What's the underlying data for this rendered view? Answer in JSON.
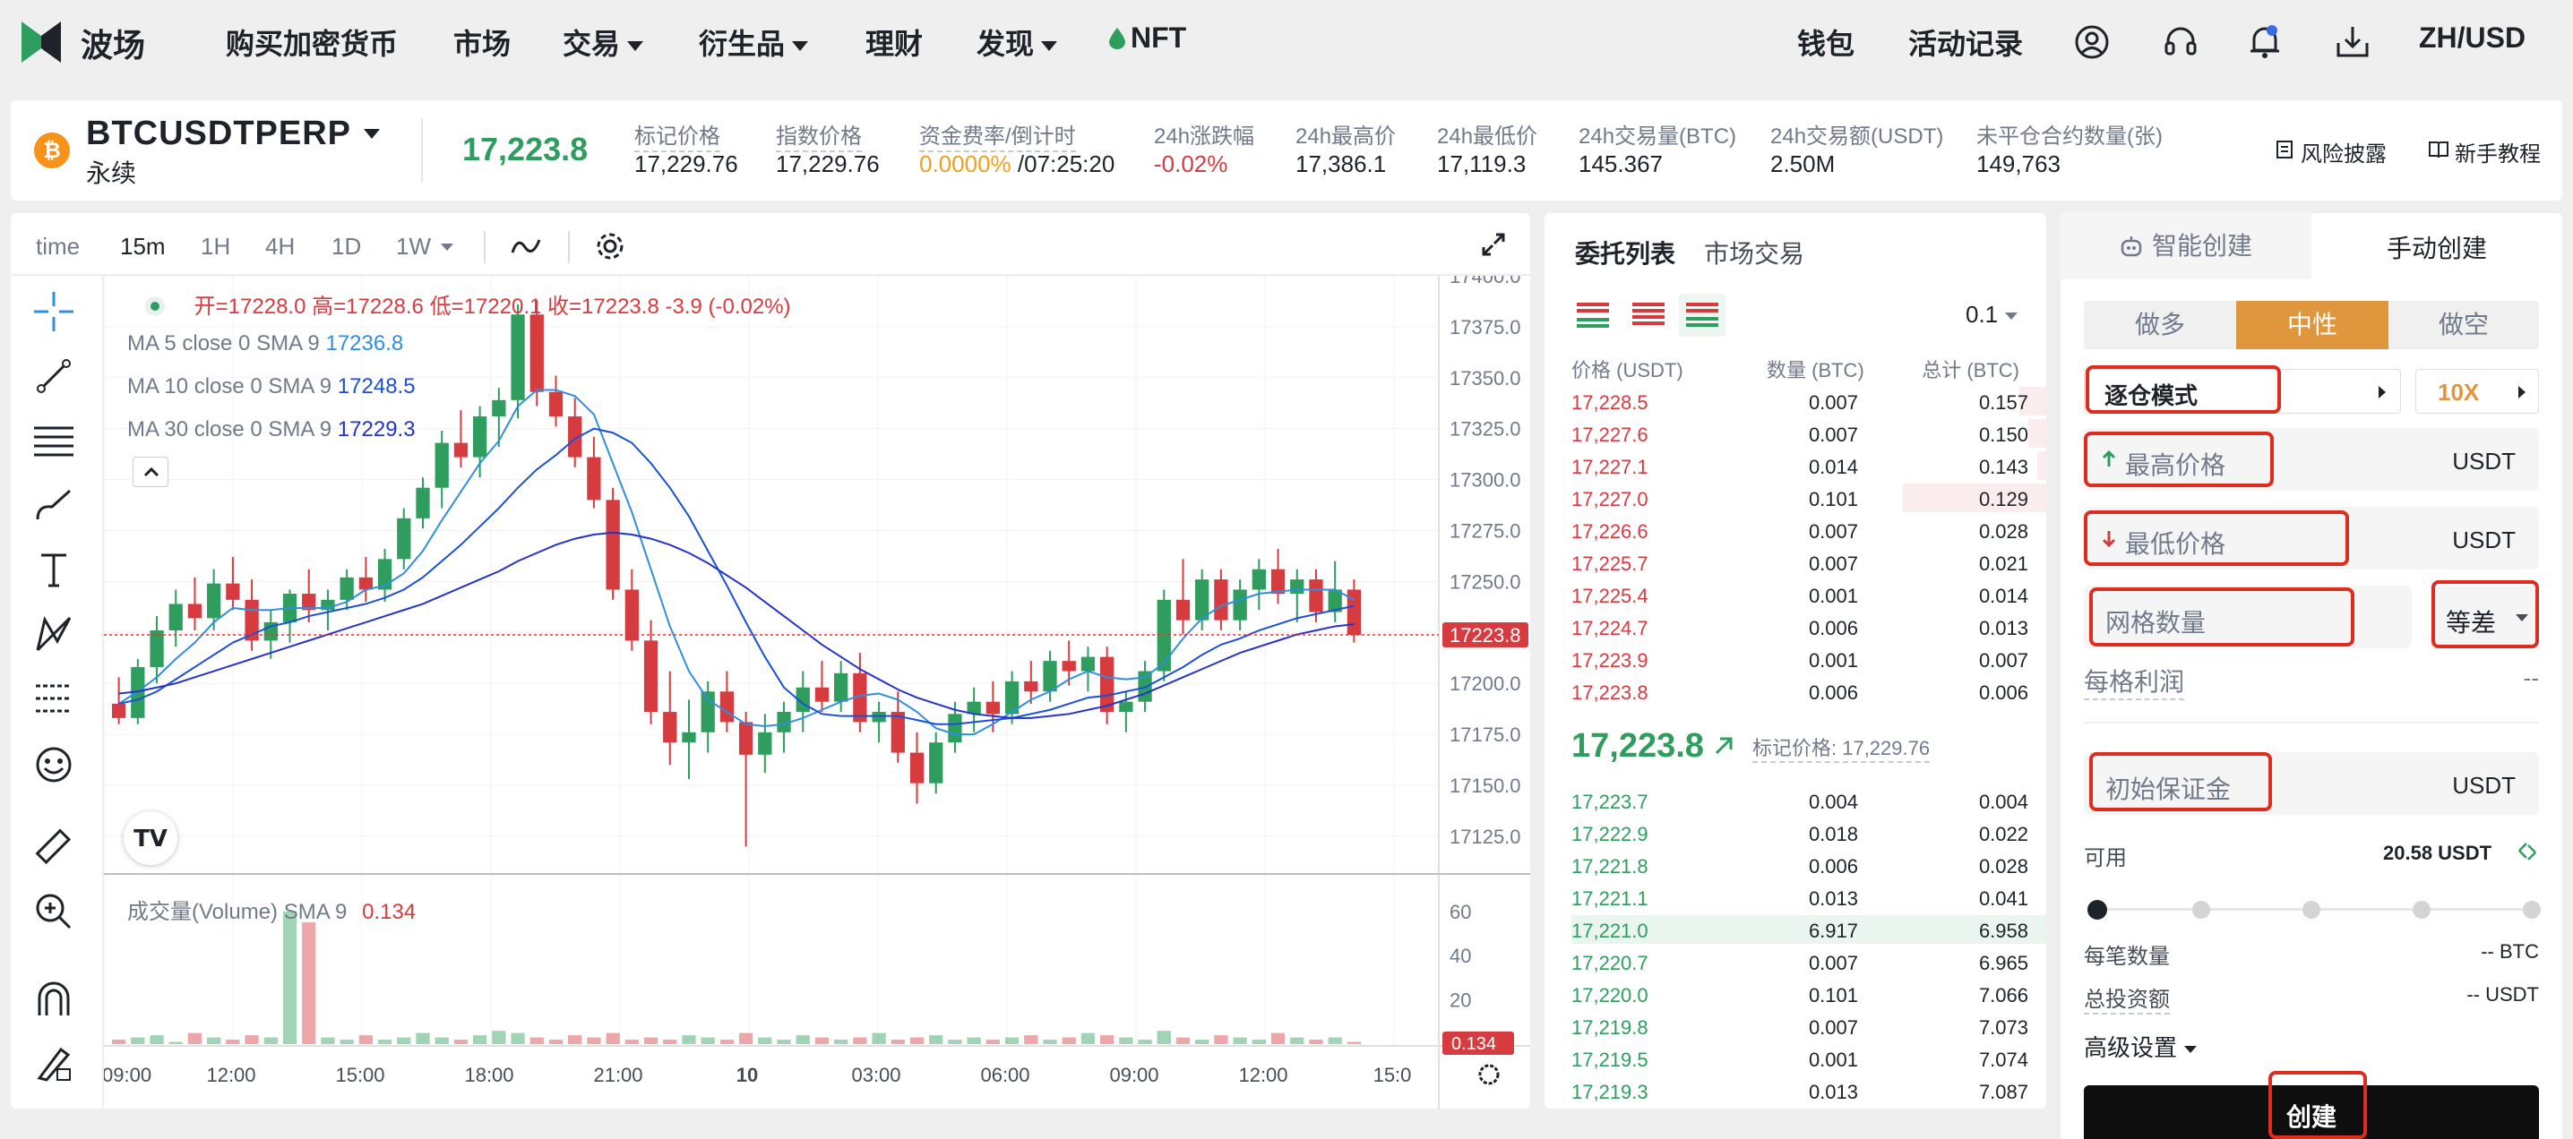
{
  "brand": {
    "name": "波场"
  },
  "nav": {
    "left": [
      {
        "label": "购买加密货币",
        "dd": false
      },
      {
        "label": "市场",
        "dd": false
      },
      {
        "label": "交易",
        "dd": true
      },
      {
        "label": "衍生品",
        "dd": true
      },
      {
        "label": "理财",
        "dd": false
      },
      {
        "label": "发现",
        "dd": true
      },
      {
        "label": "NFT",
        "dd": false
      }
    ],
    "right": {
      "wallet": "钱包",
      "activity": "活动记录",
      "lang": "ZH/USD"
    }
  },
  "ticker": {
    "symbol": "BTCUSDTPERP",
    "type": "永续",
    "price": "17,223.8",
    "stats": [
      {
        "label": "标记价格",
        "value": "17,229.76"
      },
      {
        "label": "指数价格",
        "value": "17,229.76"
      },
      {
        "label": "资金费率/倒计时",
        "value": "0.0000%",
        "value2": " /07:25:20"
      },
      {
        "label": "24h涨跌幅",
        "value": "-0.02%"
      },
      {
        "label": "24h最高价",
        "value": "17,386.1"
      },
      {
        "label": "24h最低价",
        "value": "17,119.3"
      },
      {
        "label": "24h交易量(BTC)",
        "value": "145.367"
      },
      {
        "label": "24h交易额(USDT)",
        "value": "2.50M"
      },
      {
        "label": "未平仓合约数量(张)",
        "value": "149,763"
      }
    ],
    "risk": "风险披露",
    "guide": "新手教程"
  },
  "colors": {
    "up": "#2e9d5e",
    "down": "#d63b3f",
    "accent": "#e0963c",
    "highlight": "#e02b1f"
  },
  "chart": {
    "toolbar": [
      "time",
      "15m",
      "1H",
      "4H",
      "1D",
      "1W"
    ],
    "active_interval": "15m",
    "legend": {
      "open": "开=17228.0",
      "high": "高=17228.6",
      "low": "低=17220.1",
      "close": "收=17223.8",
      "change": "-3.9 (-0.02%)"
    },
    "ma": [
      {
        "label": "MA 5 close 0 SMA 9",
        "value": "17236.8",
        "color": "#2f8ee0"
      },
      {
        "label": "MA 10 close 0 SMA 9",
        "value": "17248.5",
        "color": "#1a4fd8"
      },
      {
        "label": "MA 30 close 0 SMA 9",
        "value": "17229.3",
        "color": "#2433c8"
      }
    ],
    "volume_label": "成交量(Volume) SMA 9",
    "volume_value": "0.134",
    "price_ticks": [
      "17400.0",
      "17375.0",
      "17350.0",
      "17325.0",
      "17300.0",
      "17275.0",
      "17250.0",
      "17225.0",
      "17200.0",
      "17175.0",
      "17150.0",
      "17125.0"
    ],
    "current_price_tag": "17223.8",
    "volume_ticks": [
      "60",
      "40",
      "20"
    ],
    "volume_tag": "0.134",
    "time_ticks": [
      "09:00",
      "12:00",
      "15:00",
      "18:00",
      "21:00",
      "10",
      "03:00",
      "06:00",
      "09:00",
      "12:00",
      "15:0"
    ]
  },
  "chart_data": {
    "type": "candlestick",
    "ylim": [
      17110,
      17400
    ],
    "candles": [
      [
        17190,
        17203,
        17180,
        17183
      ],
      [
        17183,
        17212,
        17180,
        17208
      ],
      [
        17208,
        17233,
        17200,
        17226
      ],
      [
        17226,
        17246,
        17218,
        17239
      ],
      [
        17239,
        17252,
        17226,
        17232
      ],
      [
        17232,
        17256,
        17226,
        17249
      ],
      [
        17249,
        17262,
        17236,
        17241
      ],
      [
        17241,
        17251,
        17216,
        17221
      ],
      [
        17221,
        17236,
        17212,
        17230
      ],
      [
        17230,
        17246,
        17220,
        17244
      ],
      [
        17244,
        17256,
        17230,
        17236
      ],
      [
        17236,
        17246,
        17226,
        17241
      ],
      [
        17241,
        17256,
        17236,
        17252
      ],
      [
        17252,
        17262,
        17240,
        17246
      ],
      [
        17246,
        17266,
        17240,
        17261
      ],
      [
        17261,
        17286,
        17256,
        17281
      ],
      [
        17281,
        17301,
        17276,
        17296
      ],
      [
        17296,
        17324,
        17286,
        17318
      ],
      [
        17318,
        17334,
        17306,
        17311
      ],
      [
        17311,
        17336,
        17301,
        17331
      ],
      [
        17331,
        17345,
        17316,
        17339
      ],
      [
        17339,
        17386,
        17330,
        17381
      ],
      [
        17381,
        17388,
        17336,
        17343
      ],
      [
        17343,
        17351,
        17326,
        17331
      ],
      [
        17331,
        17340,
        17306,
        17311
      ],
      [
        17311,
        17321,
        17286,
        17290
      ],
      [
        17290,
        17296,
        17241,
        17246
      ],
      [
        17246,
        17256,
        17216,
        17221
      ],
      [
        17221,
        17231,
        17180,
        17186
      ],
      [
        17186,
        17206,
        17160,
        17171
      ],
      [
        17171,
        17192,
        17153,
        17176
      ],
      [
        17176,
        17201,
        17166,
        17196
      ],
      [
        17196,
        17206,
        17176,
        17181
      ],
      [
        17181,
        17186,
        17120,
        17165
      ],
      [
        17165,
        17185,
        17156,
        17176
      ],
      [
        17176,
        17191,
        17166,
        17186
      ],
      [
        17186,
        17206,
        17176,
        17198
      ],
      [
        17198,
        17211,
        17186,
        17191
      ],
      [
        17191,
        17211,
        17186,
        17205
      ],
      [
        17205,
        17215,
        17176,
        17181
      ],
      [
        17181,
        17191,
        17171,
        17186
      ],
      [
        17186,
        17196,
        17161,
        17166
      ],
      [
        17166,
        17176,
        17141,
        17151
      ],
      [
        17151,
        17176,
        17146,
        17171
      ],
      [
        17171,
        17191,
        17166,
        17185
      ],
      [
        17185,
        17198,
        17176,
        17191
      ],
      [
        17191,
        17201,
        17176,
        17185
      ],
      [
        17185,
        17206,
        17180,
        17201
      ],
      [
        17201,
        17211,
        17190,
        17196
      ],
      [
        17196,
        17216,
        17191,
        17211
      ],
      [
        17211,
        17221,
        17199,
        17206
      ],
      [
        17206,
        17218,
        17196,
        17213
      ],
      [
        17213,
        17218,
        17180,
        17186
      ],
      [
        17186,
        17196,
        17176,
        17191
      ],
      [
        17191,
        17211,
        17186,
        17206
      ],
      [
        17206,
        17246,
        17201,
        17241
      ],
      [
        17241,
        17261,
        17224,
        17231
      ],
      [
        17231,
        17256,
        17226,
        17251
      ],
      [
        17251,
        17256,
        17226,
        17231
      ],
      [
        17231,
        17251,
        17226,
        17246
      ],
      [
        17246,
        17261,
        17236,
        17256
      ],
      [
        17256,
        17266,
        17239,
        17244
      ],
      [
        17244,
        17256,
        17230,
        17251
      ],
      [
        17251,
        17256,
        17230,
        17235
      ],
      [
        17235,
        17260,
        17230,
        17246
      ],
      [
        17246,
        17251,
        17220,
        17223.8
      ]
    ],
    "volume": [
      2,
      3,
      4,
      1,
      5,
      3,
      2,
      4,
      3,
      60,
      55,
      3,
      2,
      4,
      2,
      3,
      5,
      3,
      2,
      4,
      6,
      5,
      3,
      2,
      4,
      3,
      5,
      2,
      3,
      2,
      4,
      3,
      2,
      5,
      3,
      2,
      4,
      3,
      2,
      3,
      5,
      2,
      3,
      4,
      2,
      3,
      2,
      3,
      4,
      2,
      3,
      5,
      4,
      3,
      2,
      6,
      3,
      2,
      4,
      3,
      2,
      5,
      3,
      2,
      3,
      1
    ],
    "ma": [
      {
        "name": "MA 5",
        "values": [
          17190,
          17196,
          17203,
          17212,
          17220,
          17230,
          17237,
          17236,
          17236,
          17237,
          17237,
          17237,
          17240,
          17246,
          17248,
          17254,
          17265,
          17280,
          17294,
          17308,
          17319,
          17336,
          17344,
          17344,
          17341,
          17332,
          17308,
          17284,
          17256,
          17228,
          17206,
          17192,
          17186,
          17180,
          17179,
          17180,
          17183,
          17187,
          17191,
          17194,
          17195,
          17192,
          17186,
          17178,
          17175,
          17175,
          17180,
          17186,
          17192,
          17196,
          17202,
          17206,
          17203,
          17202,
          17203,
          17210,
          17222,
          17232,
          17238,
          17241,
          17244,
          17245,
          17246,
          17246,
          17246,
          17241
        ]
      },
      {
        "name": "MA 10",
        "values": [
          17190,
          17192,
          17196,
          17202,
          17208,
          17214,
          17220,
          17224,
          17228,
          17230,
          17233,
          17235,
          17237,
          17239,
          17242,
          17246,
          17252,
          17260,
          17268,
          17277,
          17286,
          17296,
          17305,
          17312,
          17320,
          17325,
          17323,
          17318,
          17308,
          17296,
          17282,
          17265,
          17248,
          17230,
          17213,
          17198,
          17190,
          17185,
          17184,
          17184,
          17184,
          17184,
          17182,
          17180,
          17180,
          17181,
          17182,
          17183,
          17185,
          17187,
          17190,
          17193,
          17194,
          17196,
          17198,
          17203,
          17208,
          17214,
          17219,
          17222,
          17226,
          17229,
          17232,
          17234,
          17236,
          17238
        ]
      },
      {
        "name": "MA 30",
        "values": [
          17195,
          17196,
          17198,
          17200,
          17203,
          17206,
          17209,
          17212,
          17215,
          17218,
          17221,
          17224,
          17227,
          17230,
          17233,
          17236,
          17239,
          17243,
          17247,
          17251,
          17255,
          17260,
          17264,
          17268,
          17271,
          17273,
          17274,
          17273,
          17271,
          17268,
          17264,
          17259,
          17253,
          17247,
          17240,
          17233,
          17226,
          17219,
          17213,
          17207,
          17202,
          17197,
          17193,
          17190,
          17187,
          17185,
          17184,
          17183,
          17183,
          17184,
          17185,
          17187,
          17189,
          17192,
          17195,
          17199,
          17203,
          17207,
          17211,
          17215,
          17218,
          17221,
          17224,
          17226,
          17228,
          17229
        ]
      }
    ]
  },
  "orderbook": {
    "tabs": [
      "委托列表",
      "市场交易"
    ],
    "precision": "0.1",
    "headers": [
      "价格 (USDT)",
      "数量 (BTC)",
      "总计 (BTC)"
    ],
    "asks": [
      [
        "17,228.5",
        "0.007",
        "0.157",
        40
      ],
      [
        "17,227.6",
        "0.007",
        "0.150",
        30
      ],
      [
        "17,227.1",
        "0.014",
        "0.143",
        20
      ],
      [
        "17,227.0",
        "0.101",
        "0.129",
        170
      ],
      [
        "17,226.6",
        "0.007",
        "0.028",
        10
      ],
      [
        "17,225.7",
        "0.007",
        "0.021",
        8
      ],
      [
        "17,225.4",
        "0.001",
        "0.014",
        6
      ],
      [
        "17,224.7",
        "0.006",
        "0.013",
        6
      ],
      [
        "17,223.9",
        "0.001",
        "0.007",
        4
      ],
      [
        "17,223.8",
        "0.006",
        "0.006",
        4
      ]
    ],
    "mid_price": "17,223.8",
    "mark_label": "标记价格: 17,229.76",
    "bids": [
      [
        "17,223.7",
        "0.004",
        "0.004",
        4
      ],
      [
        "17,222.9",
        "0.018",
        "0.022",
        6
      ],
      [
        "17,221.8",
        "0.006",
        "0.028",
        8
      ],
      [
        "17,221.1",
        "0.013",
        "0.041",
        10
      ],
      [
        "17,221.0",
        "6.917",
        "6.958",
        570
      ],
      [
        "17,220.7",
        "0.007",
        "6.965",
        4
      ],
      [
        "17,220.0",
        "0.101",
        "7.066",
        4
      ],
      [
        "17,219.8",
        "0.007",
        "7.073",
        4
      ],
      [
        "17,219.5",
        "0.001",
        "7.074",
        4
      ],
      [
        "17,219.3",
        "0.013",
        "7.087",
        4
      ]
    ]
  },
  "grid": {
    "tabs": [
      "智能创建",
      "手动创建"
    ],
    "sides": [
      "做多",
      "中性",
      "做空"
    ],
    "active_side": "中性",
    "margin_mode": "逐仓模式",
    "leverage": "10X",
    "upper": "最高价格",
    "lower": "最低价格",
    "unit": "USDT",
    "grid_count": "网格数量",
    "grid_type": "等差",
    "profit_label": "每格利润",
    "profit_value": "--",
    "initial_margin": "初始保证金",
    "avail_label": "可用",
    "avail_value": "20.58 USDT",
    "per_qty_label": "每笔数量",
    "per_qty_value": "-- BTC",
    "total_label": "总投资额",
    "total_value": "-- USDT",
    "advanced": "高级设置",
    "create": "创建"
  }
}
